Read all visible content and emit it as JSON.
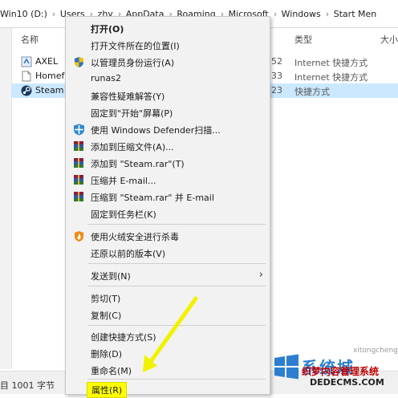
{
  "address": {
    "crumbs": [
      "Win10 (D:)",
      "Users",
      "zhy",
      "AppData",
      "Roaming",
      "Microsoft",
      "Windows",
      "Start Men"
    ]
  },
  "columns": {
    "name": "名称",
    "type": "类型",
    "size": "大小"
  },
  "files": [
    {
      "name": "AXEL",
      "num": "52",
      "type": "Internet 快捷方式"
    },
    {
      "name": "Homefr",
      "num": "33",
      "type": "Internet 快捷方式"
    },
    {
      "name": "Steam",
      "num": "23",
      "type": "快捷方式",
      "selected": true
    }
  ],
  "status": {
    "text": "目  1001 字节"
  },
  "menu": {
    "open": "打开(O)",
    "open_location": "打开文件所在的位置(I)",
    "run_as_admin": "以管理员身份运行(A)",
    "runas2": "runas2",
    "troubleshoot": "兼容性疑难解答(Y)",
    "pin_start": "固定到\"开始\"屏幕(P)",
    "defender_scan": "使用 Windows Defender扫描...",
    "add_archive": "添加到压缩文件(A)...",
    "add_steam_rar": "添加到 \"Steam.rar\"(T)",
    "compress_email": "压缩并 E-mail...",
    "compress_steam_email": "压缩到 \"Steam.rar\" 并 E-mail",
    "pin_taskbar": "固定到任务栏(K)",
    "huorong_scan": "使用火绒安全进行杀毒",
    "restore_previous": "还原以前的版本(V)",
    "send_to": "发送到(N)",
    "cut": "剪切(T)",
    "copy": "复制(C)",
    "create_shortcut": "创建快捷方式(S)",
    "delete": "删除(D)",
    "rename": "重命名(M)",
    "properties": "属性(R)"
  },
  "watermark": {
    "brand": "系统城",
    "sub1": "织梦内容管理系统",
    "sub2": "DEDECMS.COM",
    "url": "xitongcheng.com"
  },
  "colors": {
    "menu_bg": "#f2f2f2",
    "selection": "#cce8ff",
    "highlight": "#ffff00",
    "watermark_blue": "#2c7fd0",
    "watermark_red": "#c00000"
  }
}
